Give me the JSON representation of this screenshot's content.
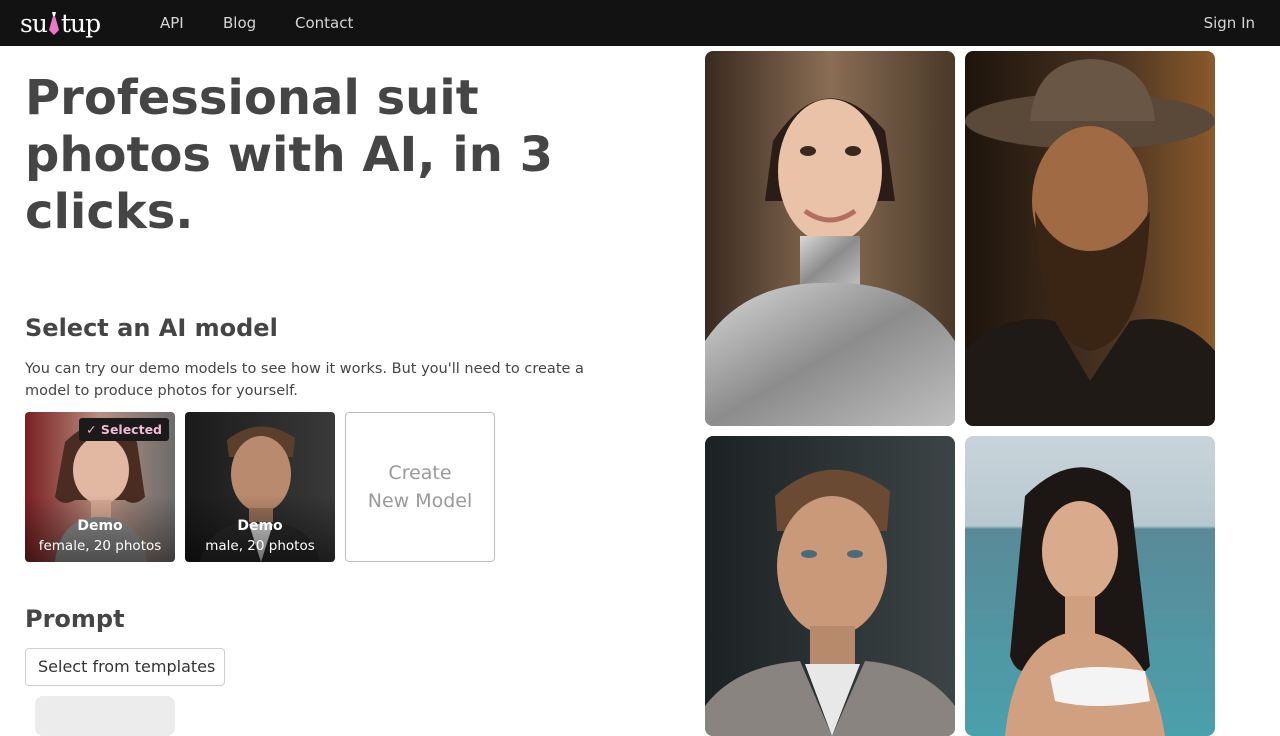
{
  "nav": {
    "logo_text": "suitup",
    "links": [
      "API",
      "Blog",
      "Contact"
    ],
    "signin": "Sign In"
  },
  "hero": {
    "title": "Professional suit photos with AI, in 3 clicks."
  },
  "models": {
    "heading": "Select an AI model",
    "description": "You can try our demo models to see how it works. But you'll need to create a model to produce photos for yourself.",
    "cards": [
      {
        "name": "Demo",
        "desc": "female, 20 photos",
        "selected_label": "✓ Selected"
      },
      {
        "name": "Demo",
        "desc": "male, 20 photos"
      }
    ],
    "create_label_1": "Create",
    "create_label_2": "New Model"
  },
  "prompt": {
    "heading": "Prompt",
    "template_button": "Select from templates"
  },
  "gallery": [
    {
      "name": "woman-silver-turtleneck-photo"
    },
    {
      "name": "bearded-man-hat-photo"
    },
    {
      "name": "man-grey-blazer-photo"
    },
    {
      "name": "woman-sea-background-photo"
    }
  ],
  "colors": {
    "topbar": "#121212",
    "accent_pink": "#f5b8d8",
    "text_dark": "#454545"
  }
}
